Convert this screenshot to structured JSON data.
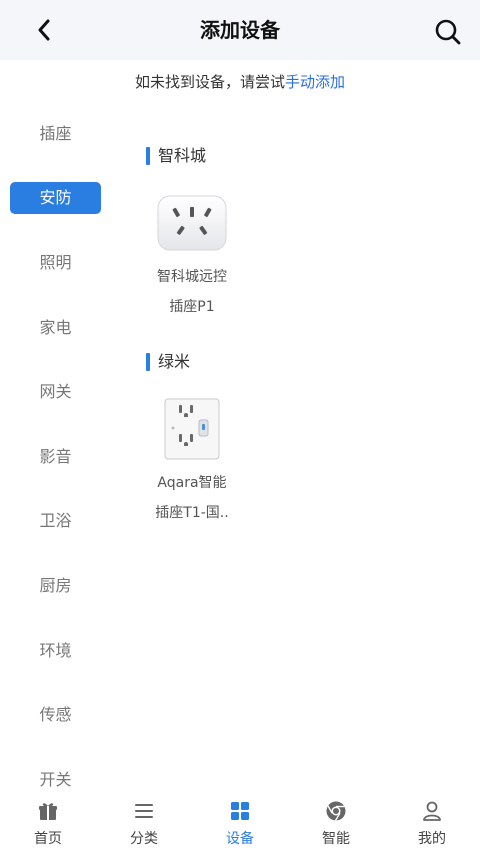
{
  "header": {
    "title": "添加设备",
    "back_icon": "chevron-left-icon",
    "search_icon": "search-icon"
  },
  "notice": {
    "text": "如未找到设备，请尝试",
    "link": "手动添加"
  },
  "sidebar": {
    "items": [
      {
        "label": "插座",
        "active": false
      },
      {
        "label": "安防",
        "active": true
      },
      {
        "label": "照明",
        "active": false
      },
      {
        "label": "家电",
        "active": false
      },
      {
        "label": "网关",
        "active": false
      },
      {
        "label": "影音",
        "active": false
      },
      {
        "label": "卫浴",
        "active": false
      },
      {
        "label": "厨房",
        "active": false
      },
      {
        "label": "环境",
        "active": false
      },
      {
        "label": "传感",
        "active": false
      },
      {
        "label": "开关",
        "active": false
      }
    ]
  },
  "groups": [
    {
      "title": "智科城",
      "devices": [
        {
          "name_line1": "智科城远控",
          "name_line2": "插座P1",
          "icon": "socket-plug-icon"
        }
      ]
    },
    {
      "title": "绿米",
      "devices": [
        {
          "name_line1": "Aqara智能",
          "name_line2": "插座T1-国..",
          "icon": "wall-socket-icon"
        }
      ]
    }
  ],
  "tabbar": {
    "tabs": [
      {
        "label": "首页",
        "icon": "gift-icon",
        "active": false
      },
      {
        "label": "分类",
        "icon": "menu-icon",
        "active": false
      },
      {
        "label": "设备",
        "icon": "grid-icon",
        "active": true
      },
      {
        "label": "智能",
        "icon": "chrome-icon",
        "active": false
      },
      {
        "label": "我的",
        "icon": "user-icon",
        "active": false
      }
    ]
  },
  "colors": {
    "accent": "#2a7de1",
    "link": "#2a6fe0",
    "header_bg": "#f4f6f9"
  }
}
